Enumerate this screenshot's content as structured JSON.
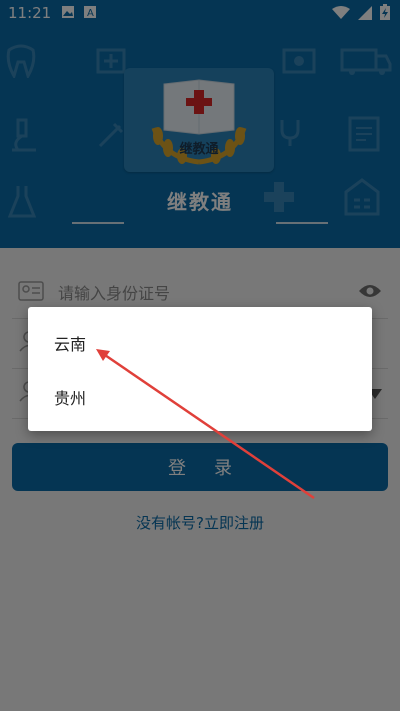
{
  "status_bar": {
    "time": "11:21",
    "left_icons": [
      "image-icon",
      "a-letter-icon"
    ],
    "right_icons": [
      "wifi-icon",
      "signal-icon",
      "battery-charging-icon"
    ]
  },
  "hero": {
    "app_title": "继教通",
    "logo_text": "继教通",
    "background_color": "#0a6aa6"
  },
  "form": {
    "id_field": {
      "placeholder": "请输入身份证号",
      "value": ""
    },
    "name_field": {
      "placeholder": "",
      "value": ""
    },
    "province_field": {
      "value": ""
    }
  },
  "login_button": {
    "label": "登录"
  },
  "register_link": {
    "label": "没有帐号?立即注册"
  },
  "dialog": {
    "options": [
      "云南",
      "贵州"
    ]
  },
  "colors": {
    "primary": "#0a6aa6",
    "annotation_arrow": "#e0403a",
    "overlay": "rgba(0,0,0,0.5)"
  }
}
